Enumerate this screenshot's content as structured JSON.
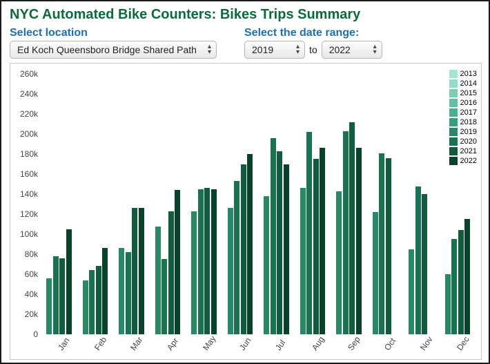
{
  "title": "NYC Automated Bike Counters: Bikes Trips Summary",
  "controls": {
    "location_label": "Select location",
    "location_value": "Ed Koch Queensboro Bridge Shared Path",
    "date_label": "Select the date range:",
    "start_value": "2019",
    "end_value": "2022",
    "to_label": "to"
  },
  "legend_years": [
    "2013",
    "2014",
    "2015",
    "2016",
    "2017",
    "2018",
    "2019",
    "2020",
    "2021",
    "2022"
  ],
  "legend_colors": {
    "2013": "#a1e8d3",
    "2014": "#8fdfc7",
    "2015": "#7ad0b6",
    "2016": "#63bfa3",
    "2017": "#4caf8f",
    "2018": "#379d7a",
    "2019": "#278a65",
    "2020": "#1a7350",
    "2021": "#105d3e",
    "2022": "#08422b"
  },
  "chart_data": {
    "type": "bar",
    "xlabel": "",
    "ylabel": "",
    "ylim": [
      0,
      265000
    ],
    "y_ticks": [
      0,
      20000,
      40000,
      60000,
      80000,
      100000,
      120000,
      140000,
      160000,
      180000,
      200000,
      220000,
      240000,
      260000
    ],
    "categories": [
      "Jan",
      "Feb",
      "Mar",
      "Apr",
      "May",
      "Jun",
      "Jul",
      "Aug",
      "Sep",
      "Oct",
      "Nov",
      "Dec"
    ],
    "series": [
      {
        "name": "2019",
        "color": "#278a65",
        "values": [
          56000,
          54000,
          86000,
          108000,
          123000,
          126000,
          138000,
          146000,
          143000,
          122000,
          85000,
          60000
        ]
      },
      {
        "name": "2020",
        "color": "#1a7350",
        "values": [
          78000,
          64000,
          82000,
          75000,
          145000,
          153000,
          196000,
          202000,
          203000,
          181000,
          148000,
          95000
        ]
      },
      {
        "name": "2021",
        "color": "#105d3e",
        "values": [
          76000,
          68000,
          126000,
          123000,
          146000,
          170000,
          183000,
          175000,
          212000,
          176000,
          140000,
          104000
        ]
      },
      {
        "name": "2022",
        "color": "#08422b",
        "values": [
          105000,
          86000,
          126000,
          144000,
          145000,
          180000,
          170000,
          186000,
          186000,
          null,
          null,
          115000
        ]
      }
    ]
  }
}
